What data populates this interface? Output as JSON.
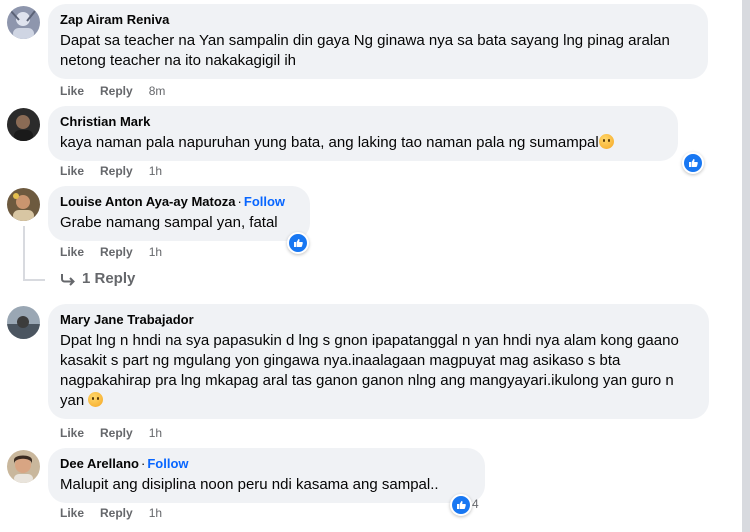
{
  "comments": [
    {
      "author": "Zap Airam Reniva",
      "text": "Dapat sa teacher na Yan sampalin din gaya Ng ginawa nya sa bata sayang lng pinag aralan netong teacher na ito nakakagigil ih",
      "like": "Like",
      "reply": "Reply",
      "time": "8m"
    },
    {
      "author": "Christian Mark",
      "text": "kaya naman pala napuruhan yung bata, ang laking tao naman pala ng sumampal",
      "like": "Like",
      "reply": "Reply",
      "time": "1h"
    },
    {
      "author": "Louise Anton Aya-ay Matoza",
      "follow": "Follow",
      "text": "Grabe namang sampal yan, fatal",
      "like": "Like",
      "reply": "Reply",
      "time": "1h",
      "replies_label": "1 Reply"
    },
    {
      "author": "Mary Jane Trabajador",
      "text": "Dpat lng n hndi na sya papasukin d lng s gnon ipapatanggal n yan hndi nya alam kong gaano kasakit s part ng mgulang yon gingawa nya.inaalagaan magpuyat mag asikaso s bta nagpakahirap pra lng mkapag aral tas ganon ganon nlng ang mangyayari.ikulong yan guro n yan",
      "like": "Like",
      "reply": "Reply",
      "time": "1h"
    },
    {
      "author": "Dee Arellano",
      "follow": "Follow",
      "text": "Malupit ang disiplina noon peru ndi kasama ang sampal..",
      "like": "Like",
      "reply": "Reply",
      "time": "1h",
      "reaction_count": "4"
    }
  ],
  "colors": {
    "bubble": "#f0f2f5",
    "link_blue": "#0866ff",
    "like_blue": "#1877f2",
    "meta_gray": "#65676b"
  }
}
